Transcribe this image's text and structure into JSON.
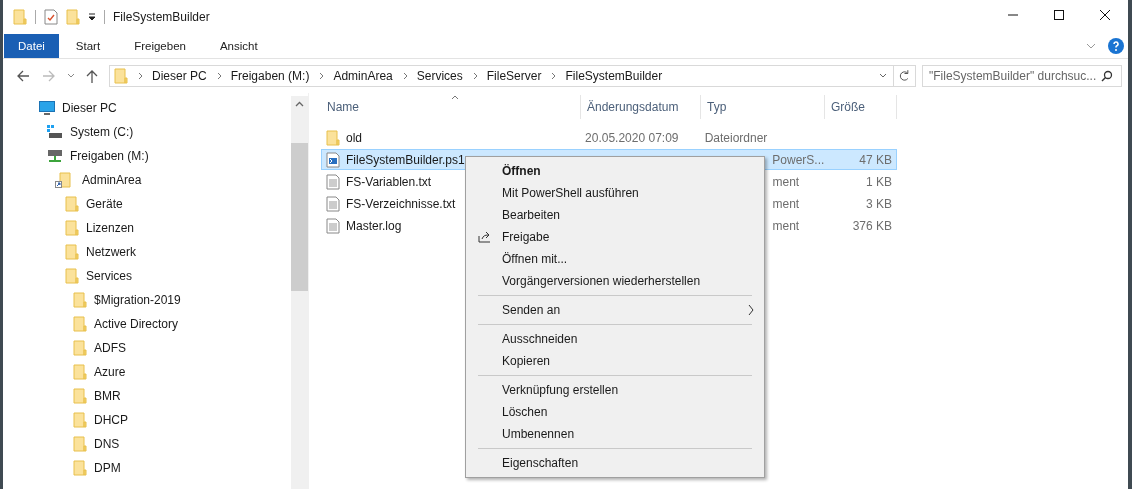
{
  "window": {
    "title": "FileSystemBuilder"
  },
  "ribbon_tabs": [
    {
      "label": "Datei",
      "selected": true
    },
    {
      "label": "Start",
      "selected": false
    },
    {
      "label": "Freigeben",
      "selected": false
    },
    {
      "label": "Ansicht",
      "selected": false
    }
  ],
  "breadcrumb": [
    "Dieser PC",
    "Freigaben (M:)",
    "AdminArea",
    "Services",
    "FileServer",
    "FileSystemBuilder"
  ],
  "search": {
    "placeholder": "\"FileSystemBuilder\" durchsuc..."
  },
  "sidebar": {
    "items": [
      {
        "label": "Dieser PC",
        "kind": "pc",
        "children": [
          {
            "label": "System (C:)",
            "kind": "drive"
          },
          {
            "label": "Freigaben (M:)",
            "kind": "netdrive",
            "children": [
              {
                "label": "AdminArea",
                "kind": "shortcut",
                "children": [
                  {
                    "label": "Geräte",
                    "kind": "folder"
                  },
                  {
                    "label": "Lizenzen",
                    "kind": "folder"
                  },
                  {
                    "label": "Netzwerk",
                    "kind": "folder"
                  },
                  {
                    "label": "Services",
                    "kind": "folder",
                    "children": [
                      {
                        "label": "$Migration-2019",
                        "kind": "folder"
                      },
                      {
                        "label": "Active Directory",
                        "kind": "folder"
                      },
                      {
                        "label": "ADFS",
                        "kind": "folder"
                      },
                      {
                        "label": "Azure",
                        "kind": "folder"
                      },
                      {
                        "label": "BMR",
                        "kind": "folder"
                      },
                      {
                        "label": "DHCP",
                        "kind": "folder"
                      },
                      {
                        "label": "DNS",
                        "kind": "folder"
                      },
                      {
                        "label": "DPM",
                        "kind": "folder"
                      }
                    ]
                  }
                ]
              }
            ]
          }
        ]
      }
    ]
  },
  "table": {
    "columns": [
      "Name",
      "Änderungsdatum",
      "Typ",
      "Größe"
    ],
    "rows": [
      {
        "kind": "folder",
        "name": "old",
        "date": "20.05.2020 07:09",
        "type": "Dateiordner",
        "type_covered": false,
        "size": "",
        "selected": false
      },
      {
        "kind": "script",
        "name": "FileSystemBuilder.ps1",
        "type": "PowerS...",
        "type_covered": true,
        "size": "47 KB",
        "selected": true
      },
      {
        "kind": "text",
        "name": "FS-Variablen.txt",
        "type": "ment",
        "type_covered": true,
        "size": "1 KB",
        "selected": false
      },
      {
        "kind": "text",
        "name": "FS-Verzeichnisse.txt",
        "type": "ment",
        "type_covered": true,
        "size": "3 KB",
        "selected": false
      },
      {
        "kind": "text",
        "name": "Master.log",
        "type": "ment",
        "type_covered": true,
        "size": "376 KB",
        "selected": false
      }
    ]
  },
  "context_menu": [
    {
      "kind": "item",
      "label": "Öffnen",
      "default": true
    },
    {
      "kind": "item",
      "label": "Mit PowerShell ausführen",
      "default": false
    },
    {
      "kind": "item",
      "label": "Bearbeiten",
      "default": false
    },
    {
      "kind": "share",
      "label": "Freigabe",
      "default": false
    },
    {
      "kind": "item",
      "label": "Öffnen mit...",
      "default": false
    },
    {
      "kind": "item",
      "label": "Vorgängerversionen wiederherstellen",
      "default": false
    },
    {
      "kind": "separator"
    },
    {
      "kind": "submenu",
      "label": "Senden an",
      "default": false
    },
    {
      "kind": "separator"
    },
    {
      "kind": "item",
      "label": "Ausschneiden",
      "default": false
    },
    {
      "kind": "item",
      "label": "Kopieren",
      "default": false
    },
    {
      "kind": "separator"
    },
    {
      "kind": "item",
      "label": "Verknüpfung erstellen",
      "default": false
    },
    {
      "kind": "item",
      "label": "Löschen",
      "default": false
    },
    {
      "kind": "item",
      "label": "Umbenennen",
      "default": false
    },
    {
      "kind": "separator"
    },
    {
      "kind": "item",
      "label": "Eigenschaften",
      "default": false
    }
  ]
}
